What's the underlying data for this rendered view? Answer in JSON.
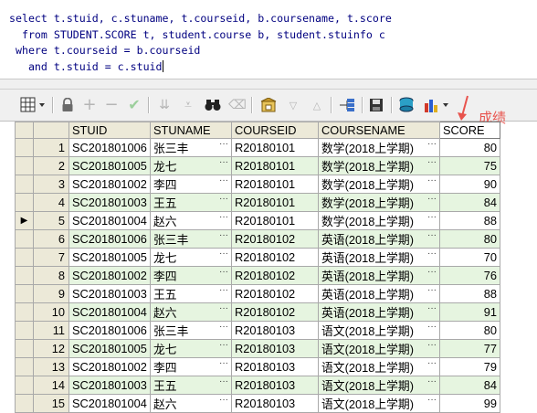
{
  "sql": {
    "lines": [
      "select t.stuid, c.stuname, t.courseid, b.coursename, t.score",
      "  from STUDENT.SCORE t, student.course b, student.stuinfo c",
      " where t.courseid = b.courseid",
      "   and t.stuid = c.stuid"
    ]
  },
  "toolbar": {
    "icons": [
      "grid-menu-icon",
      "lock-icon",
      "add-icon",
      "remove-icon",
      "check-icon",
      "filter-down-icon",
      "filter-icon",
      "binoculars-icon",
      "eraser-icon",
      "save-query-icon",
      "dropdown-arrow-icon",
      "up-arrow-icon",
      "tree-icon",
      "floppy-icon",
      "export-icon",
      "chart-icon"
    ]
  },
  "annotation": {
    "text": "成绩",
    "color": "#e8534d"
  },
  "grid": {
    "columns": [
      "STUID",
      "STUNAME",
      "COURSEID",
      "COURSENAME",
      "SCORE"
    ],
    "current_row": 5,
    "rows": [
      {
        "n": "1",
        "stuid": "SC201801006",
        "stuname": "张三丰",
        "courseid": "R20180101",
        "coursename": "数学(2018上学期)",
        "score": "80"
      },
      {
        "n": "2",
        "stuid": "SC201801005",
        "stuname": "龙七",
        "courseid": "R20180101",
        "coursename": "数学(2018上学期)",
        "score": "75"
      },
      {
        "n": "3",
        "stuid": "SC201801002",
        "stuname": "李四",
        "courseid": "R20180101",
        "coursename": "数学(2018上学期)",
        "score": "90"
      },
      {
        "n": "4",
        "stuid": "SC201801003",
        "stuname": "王五",
        "courseid": "R20180101",
        "coursename": "数学(2018上学期)",
        "score": "84"
      },
      {
        "n": "5",
        "stuid": "SC201801004",
        "stuname": "赵六",
        "courseid": "R20180101",
        "coursename": "数学(2018上学期)",
        "score": "88"
      },
      {
        "n": "6",
        "stuid": "SC201801006",
        "stuname": "张三丰",
        "courseid": "R20180102",
        "coursename": "英语(2018上学期)",
        "score": "80"
      },
      {
        "n": "7",
        "stuid": "SC201801005",
        "stuname": "龙七",
        "courseid": "R20180102",
        "coursename": "英语(2018上学期)",
        "score": "70"
      },
      {
        "n": "8",
        "stuid": "SC201801002",
        "stuname": "李四",
        "courseid": "R20180102",
        "coursename": "英语(2018上学期)",
        "score": "76"
      },
      {
        "n": "9",
        "stuid": "SC201801003",
        "stuname": "王五",
        "courseid": "R20180102",
        "coursename": "英语(2018上学期)",
        "score": "88"
      },
      {
        "n": "10",
        "stuid": "SC201801004",
        "stuname": "赵六",
        "courseid": "R20180102",
        "coursename": "英语(2018上学期)",
        "score": "91"
      },
      {
        "n": "11",
        "stuid": "SC201801006",
        "stuname": "张三丰",
        "courseid": "R20180103",
        "coursename": "语文(2018上学期)",
        "score": "80"
      },
      {
        "n": "12",
        "stuid": "SC201801005",
        "stuname": "龙七",
        "courseid": "R20180103",
        "coursename": "语文(2018上学期)",
        "score": "77"
      },
      {
        "n": "13",
        "stuid": "SC201801002",
        "stuname": "李四",
        "courseid": "R20180103",
        "coursename": "语文(2018上学期)",
        "score": "79"
      },
      {
        "n": "14",
        "stuid": "SC201801003",
        "stuname": "王五",
        "courseid": "R20180103",
        "coursename": "语文(2018上学期)",
        "score": "84"
      },
      {
        "n": "15",
        "stuid": "SC201801004",
        "stuname": "赵六",
        "courseid": "R20180103",
        "coursename": "语文(2018上学期)",
        "score": "99"
      }
    ]
  }
}
